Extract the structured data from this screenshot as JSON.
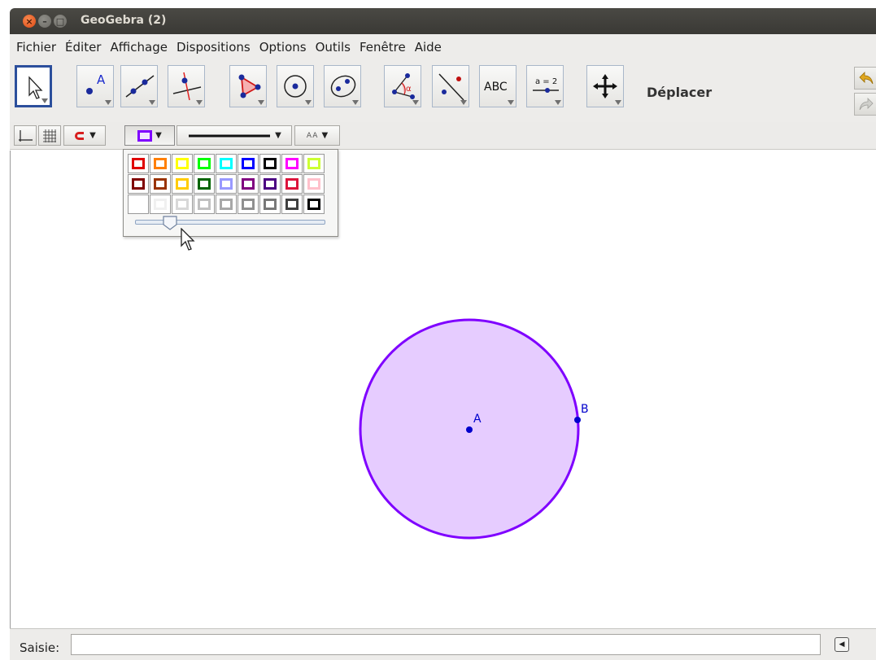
{
  "window": {
    "title": "GeoGebra (2)"
  },
  "menu": [
    "Fichier",
    "Éditer",
    "Affichage",
    "Dispositions",
    "Options",
    "Outils",
    "Fenêtre",
    "Aide"
  ],
  "toolbar": {
    "tools": [
      {
        "name": "move-tool",
        "icon": "arrow-cursor-icon",
        "selected": true
      },
      {
        "name": "point-tool",
        "icon": "point-icon",
        "label": "A"
      },
      {
        "name": "line-tool",
        "icon": "line-through-two-points-icon"
      },
      {
        "name": "perpendicular-line-tool",
        "icon": "perpendicular-line-icon"
      },
      {
        "name": "polygon-tool",
        "icon": "polygon-icon"
      },
      {
        "name": "circle-center-point-tool",
        "icon": "circle-center-point-icon"
      },
      {
        "name": "conic-five-points-tool",
        "icon": "ellipse-icon"
      },
      {
        "name": "angle-tool",
        "icon": "angle-icon",
        "label": "α"
      },
      {
        "name": "reflect-tool",
        "icon": "reflect-about-line-icon"
      },
      {
        "name": "text-tool",
        "icon": "text-icon",
        "label": "ABC"
      },
      {
        "name": "slider-tool",
        "icon": "slider-icon",
        "label": "a = 2"
      },
      {
        "name": "move-graphics-tool",
        "icon": "move-graphics-view-icon"
      }
    ],
    "active_tool_label": "Déplacer"
  },
  "stylebar": {
    "axes": "axes-icon",
    "grid": "grid-icon",
    "point_capture": "magnet-icon",
    "color_button": "color-icon",
    "line_style_button": "line-style-icon",
    "text_size_label": "AA"
  },
  "color_popup": {
    "rows": [
      [
        "#e00000",
        "#ff7f00",
        "#ffff00",
        "#00ff00",
        "#00ffff",
        "#0000ff",
        "#000000",
        "#ff00ff",
        "#ccff33"
      ],
      [
        "#800000",
        "#993300",
        "#ffcc00",
        "#006400",
        "#9999ff",
        "#800080",
        "#4b0082",
        "#dc143c",
        "#ffc0cb"
      ],
      [
        "#ffffff",
        "#f0f0f0",
        "#d8d8d8",
        "#c0c0c0",
        "#a8a8a8",
        "#909090",
        "#787878",
        "#404040",
        "#000000"
      ]
    ],
    "selected_color": "#7f00ff",
    "opacity": 0.2
  },
  "graphics": {
    "circle": {
      "fill": "#e6ccff",
      "stroke": "#7f00ff"
    },
    "points": [
      {
        "label": "A",
        "color": "#0000cc"
      },
      {
        "label": "B",
        "color": "#0000cc"
      }
    ]
  },
  "input_bar": {
    "label": "Saisie:",
    "value": ""
  }
}
